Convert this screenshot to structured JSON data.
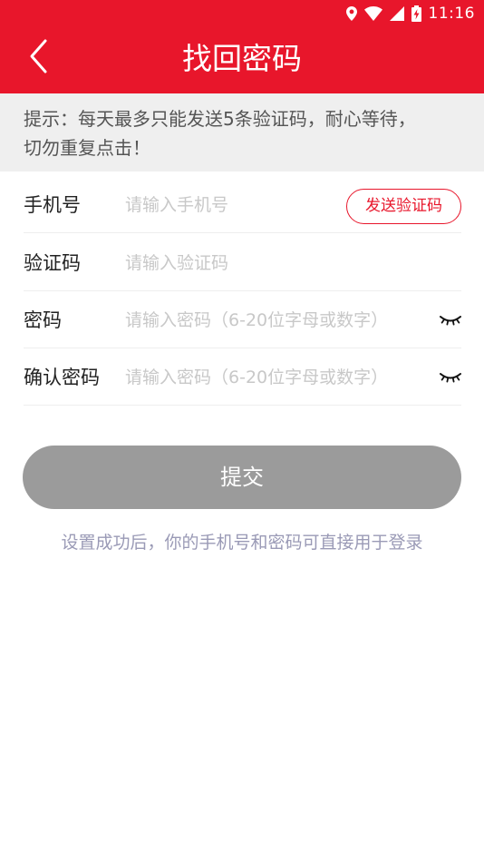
{
  "status_bar": {
    "time": "11:16",
    "icons": [
      "location-icon",
      "wifi-icon",
      "signal-icon",
      "battery-charging-icon"
    ]
  },
  "header": {
    "title": "找回密码",
    "back_icon": "chevron-left-icon"
  },
  "tip": {
    "text": "提示：每天最多只能发送5条验证码，耐心等待，切勿重复点击！"
  },
  "form": {
    "phone": {
      "label": "手机号",
      "placeholder": "请输入手机号",
      "send_code_label": "发送验证码"
    },
    "code": {
      "label": "验证码",
      "placeholder": "请输入验证码"
    },
    "password": {
      "label": "密码",
      "placeholder": "请输入密码（6-20位字母或数字）",
      "toggle_icon": "eye-closed-icon"
    },
    "confirm_password": {
      "label": "确认密码",
      "placeholder": "请输入密码（6-20位字母或数字）",
      "toggle_icon": "eye-closed-icon"
    }
  },
  "submit": {
    "label": "提交"
  },
  "note": {
    "text": "设置成功后，你的手机号和密码可直接用于登录"
  },
  "colors": {
    "brand": "#e8162b",
    "tip_bg": "#efefef",
    "button_disabled": "#9b9b9b",
    "note_text": "#9a9ab6"
  }
}
